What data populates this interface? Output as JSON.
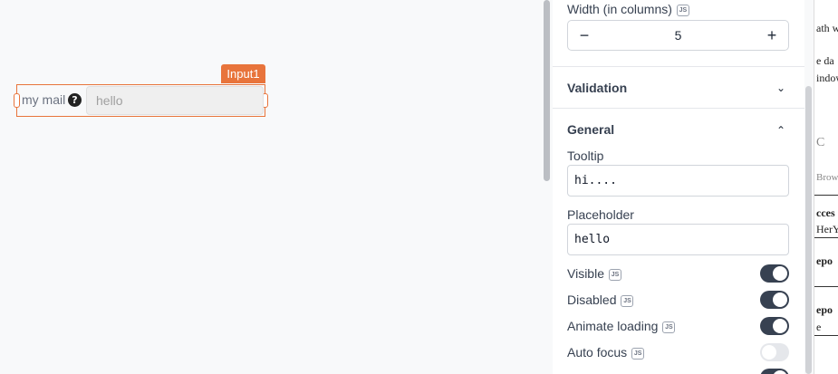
{
  "canvas": {
    "widget_tag": "Input1",
    "label": "my mail",
    "help_glyph": "?",
    "input_placeholder": "hello"
  },
  "panel": {
    "width_label": "Width (in columns)",
    "js_badge": "JS",
    "width_value": "5",
    "minus_glyph": "−",
    "plus_glyph": "+",
    "sections": {
      "validation": "Validation",
      "general": "General"
    },
    "tooltip_label": "Tooltip",
    "tooltip_value": "hi....",
    "placeholder_label": "Placeholder",
    "placeholder_value": "hello",
    "toggles": [
      {
        "label": "Visible",
        "on": true
      },
      {
        "label": "Disabled",
        "on": true
      },
      {
        "label": "Animate loading",
        "on": true
      },
      {
        "label": "Auto focus",
        "on": false
      }
    ]
  },
  "background_window": {
    "fragments": [
      "ath w",
      "e da",
      "indow",
      "C",
      "Brow",
      "cces",
      "HerY",
      "epo",
      "epo",
      "e"
    ]
  }
}
